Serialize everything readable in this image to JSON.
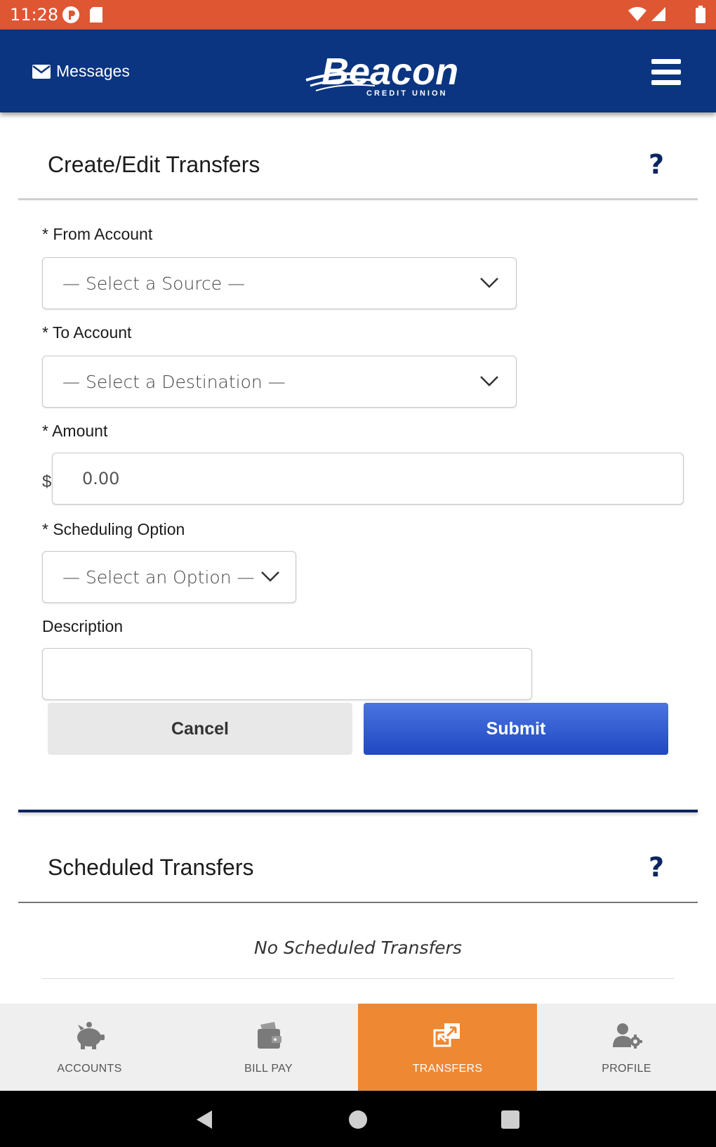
{
  "status_bar": {
    "time": "11:28"
  },
  "header": {
    "messages_label": "Messages",
    "logo_text": "Beacon",
    "logo_subtext": "CREDIT UNION"
  },
  "transfer_form": {
    "title": "Create/Edit Transfers",
    "help": "?",
    "from_label": "* From Account",
    "from_value": "— Select a Source —",
    "to_label": "* To Account",
    "to_value": "— Select a Destination —",
    "amount_label": "* Amount",
    "currency": "$",
    "amount_placeholder": "0.00",
    "scheduling_label": "* Scheduling Option",
    "scheduling_value": "— Select an Option —",
    "description_label": "Description",
    "cancel_label": "Cancel",
    "submit_label": "Submit"
  },
  "scheduled": {
    "title": "Scheduled Transfers",
    "help": "?",
    "empty_text": "No Scheduled Transfers"
  },
  "bottom_nav": {
    "items": [
      {
        "label": "ACCOUNTS",
        "icon": "piggy-bank-icon"
      },
      {
        "label": "BILL PAY",
        "icon": "wallet-icon"
      },
      {
        "label": "TRANSFERS",
        "icon": "transfer-arrows-icon",
        "active": true
      },
      {
        "label": "PROFILE",
        "icon": "user-settings-icon"
      }
    ]
  },
  "colors": {
    "status_bar": "#df5633",
    "header": "#0b3580",
    "active_tab": "#ee8833",
    "submit": "#2a55cc"
  }
}
